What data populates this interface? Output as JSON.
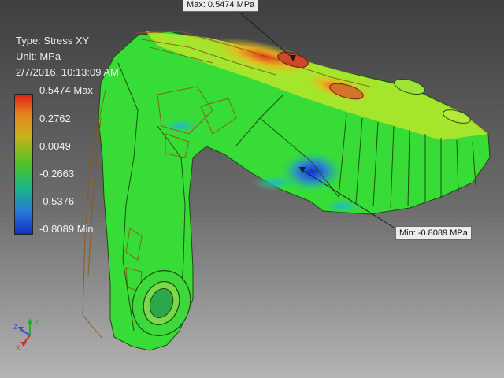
{
  "result_info": {
    "type_line": "Type: Stress XY",
    "unit_line": "Unit: MPa",
    "timestamp": "2/7/2016, 10:13:09 AM"
  },
  "legend": {
    "labels": [
      "0.5474 Max",
      "0.2762",
      "0.0049",
      "-0.2663",
      "-0.5376",
      "-0.8089 Min"
    ],
    "colors": [
      "#e0201a",
      "#e7821d",
      "#c8b21b",
      "#4cc227",
      "#18b48a",
      "#2a78d7",
      "#1130c4"
    ]
  },
  "probes": {
    "max_label": "Max: 0.5474 MPa",
    "min_label": "Min: -0.8089 MPa"
  },
  "triad": {
    "x_axis": "X",
    "y_axis": "Y",
    "z_axis": "Z"
  }
}
